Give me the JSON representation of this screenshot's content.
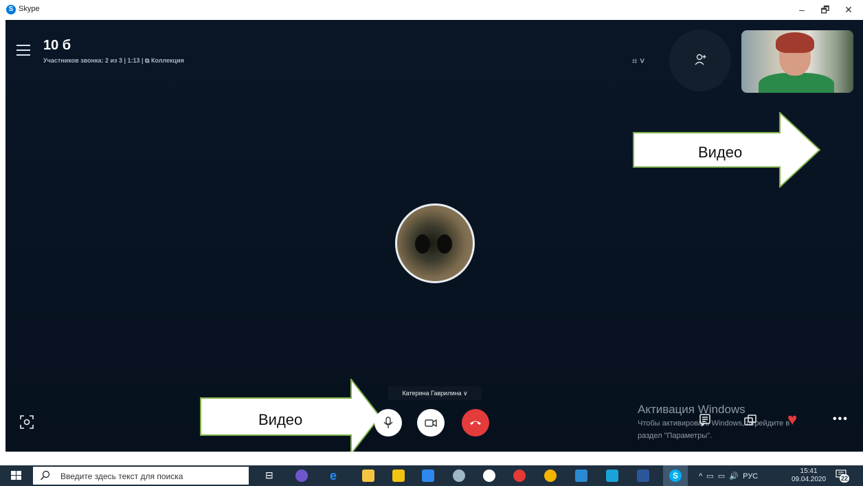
{
  "window": {
    "title": "Skype",
    "minimize": "–",
    "maximize": "🗗",
    "close": "✕"
  },
  "call": {
    "title": "10 б",
    "info": "Участников звонка: 2 из 3 | 1:13 | ⧉ Коллекция",
    "caller_name": "Катерина Гаврилина ∨"
  },
  "annotations": {
    "arrow_top_label": "Видео",
    "arrow_bottom_label": "Видео"
  },
  "watermark": {
    "line1": "Активация Windows",
    "line2": "Чтобы активировать Windows, перейдите в",
    "line3": "раздел \"Параметры\"."
  },
  "taskbar": {
    "search_placeholder": "Введите здесь текст для поиска",
    "tray_lang": "РУС",
    "time": "15:41",
    "date": "09.04.2020",
    "notifications_count": "22"
  },
  "colors": {
    "accent": "#0078d4",
    "end_call": "#e43b3b",
    "arrow_fill": "#ffffff",
    "arrow_stroke": "#7fb04a"
  }
}
